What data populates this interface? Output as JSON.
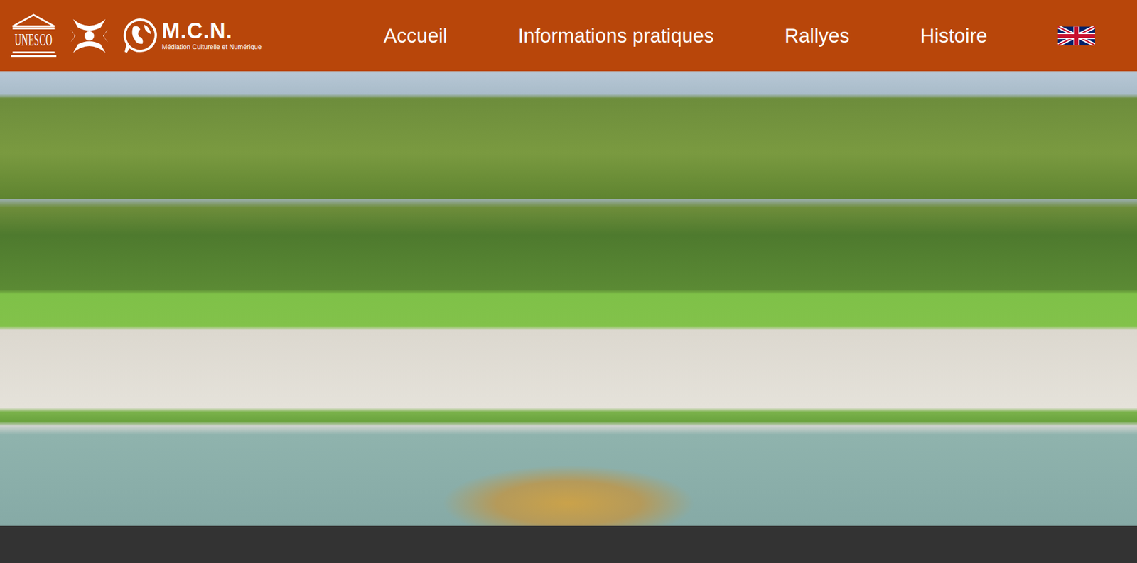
{
  "logos": {
    "unesco": "UNESCO",
    "mcn_title": "M.C.N.",
    "mcn_subtitle": "Médiation Culturelle et Numérique"
  },
  "nav": [
    {
      "label": "Accueil"
    },
    {
      "label": "Informations pratiques"
    },
    {
      "label": "Rallyes"
    },
    {
      "label": "Histoire"
    }
  ]
}
